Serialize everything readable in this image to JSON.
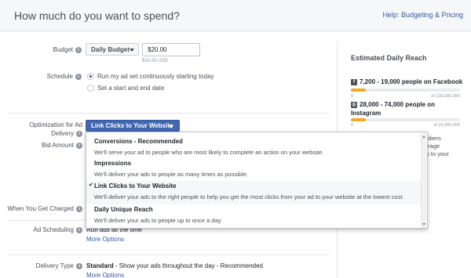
{
  "header": {
    "title": "How much do you want to spend?",
    "help_link": "Help: Budgeting & Pricing"
  },
  "budget": {
    "label": "Budget",
    "type_selected": "Daily Budget",
    "amount_value": "$20.00",
    "amount_sub": "$20.00 USD"
  },
  "schedule": {
    "label": "Schedule",
    "options": [
      {
        "label": "Run my ad set continuously starting today",
        "selected": true
      },
      {
        "label": "Set a start and end date",
        "selected": false
      }
    ]
  },
  "optimization": {
    "label_line1": "Optimization for Ad",
    "label_line2": "Delivery",
    "selected": "Link Clicks to Your Website",
    "options": [
      {
        "title": "Conversions - Recommended",
        "desc": "We'll serve your ad to people who are most likely to complete an action on your website.",
        "checked": false
      },
      {
        "title": "Impressions",
        "desc": "We'll deliver your ads to people as many times as possible.",
        "checked": false
      },
      {
        "title": "Link Clicks to Your Website",
        "desc": "We'll deliver your ads to the right people to help you get the most clicks from your ad to your website at the lowest cost.",
        "checked": true
      },
      {
        "title": "Daily Unique Reach",
        "desc": "We'll deliver your ads to people up to once a day.",
        "checked": false
      }
    ],
    "check_glyph": "✔"
  },
  "bid_amount": {
    "label": "Bid Amount"
  },
  "when_charged": {
    "label": "When You Get Charged"
  },
  "ad_scheduling": {
    "label": "Ad Scheduling",
    "value": "Run ads all the time",
    "more": "More Options"
  },
  "delivery_type": {
    "label": "Delivery Type",
    "value_bold": "Standard",
    "value_rest": " - Show your ads throughout the day - Recommended",
    "more": "More Options"
  },
  "estimated_reach": {
    "title": "Estimated Daily Reach",
    "facebook": {
      "icon": "facebook-icon",
      "text": "7,200 - 19,000 people on Facebook",
      "min": "0",
      "max": "of 130,000,000",
      "fill_fraction": 0.14
    },
    "instagram": {
      "icon": "instagram-icon",
      "text_line1": "28,000 - 74,000 people on",
      "text_line2": "Instagram",
      "min": "0",
      "max": "of 31,000,000",
      "fill_fraction": 0.14
    },
    "partial_text": [
      "mbers",
      "erage",
      "ts to your",
      "."
    ]
  },
  "colors": {
    "accent": "#4267b2",
    "link": "#365899",
    "bar_fill": "#f5a623"
  }
}
